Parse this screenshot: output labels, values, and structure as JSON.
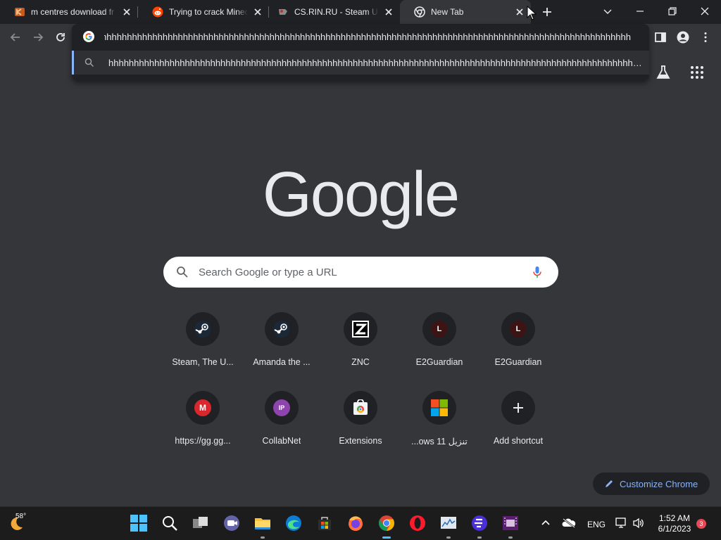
{
  "tabs": [
    {
      "title": "m centres download fr",
      "favicon": "orange-k-favicon"
    },
    {
      "title": "Trying to crack Minecra",
      "favicon": "reddit-favicon"
    },
    {
      "title": "CS.RIN.RU - Steam Unc",
      "favicon": "csrin-favicon"
    },
    {
      "title": "New Tab",
      "favicon": "chrome-favicon"
    }
  ],
  "omnibox": {
    "text": "hhhhhhhhhhhhhhhhhhhhhhhhhhhhhhhhhhhhhhhhhhhhhhhhhhhhhhhhhhhhhhhhhhhhhhhhhhhhhhhhhhhhhhhhhhhhhhhhhhhhhhhhhhhhhhhhhhhhhhh",
    "suggestion": "hhhhhhhhhhhhhhhhhhhhhhhhhhhhhhhhhhhhhhhhhhhhhhhhhhhhhhhhhhhhhhhhhhhhhhhhhhhhhhhhhhhhhhhhhhhhhhhhhhhhhhhhhhhhhhhhhh..."
  },
  "ntp": {
    "logo": "Google",
    "search_placeholder": "Search Google or type a URL",
    "customize_label": "Customize Chrome",
    "shortcuts": [
      {
        "label": "Steam, The U...",
        "icon": "steam-icon"
      },
      {
        "label": "Amanda the ...",
        "icon": "steam-icon"
      },
      {
        "label": "ZNC",
        "icon": "znc-icon"
      },
      {
        "label": "E2Guardian",
        "icon": "letter-l-icon",
        "letter": "L"
      },
      {
        "label": "E2Guardian",
        "icon": "letter-l-icon",
        "letter": "L"
      },
      {
        "label": "https://gg.gg...",
        "icon": "mega-icon",
        "letter": "M"
      },
      {
        "label": "CollabNet",
        "icon": "collabnet-icon",
        "letter": "IP"
      },
      {
        "label": "Extensions",
        "icon": "chrome-store-icon"
      },
      {
        "label": "تنزيل Windows 11...",
        "display": "...ows 11 تنزيل",
        "icon": "windows-icon"
      },
      {
        "label": "Add shortcut",
        "icon": "plus-icon"
      }
    ]
  },
  "taskbar": {
    "weather_temp": "58°",
    "language": "ENG",
    "time": "1:52 AM",
    "date": "6/1/2023",
    "notification_count": "3"
  },
  "colors": {
    "tabstrip": "#202124",
    "toolbar": "#35363a",
    "accent_blue": "#8ab4f8",
    "taskbar": "#1c1c1c"
  }
}
